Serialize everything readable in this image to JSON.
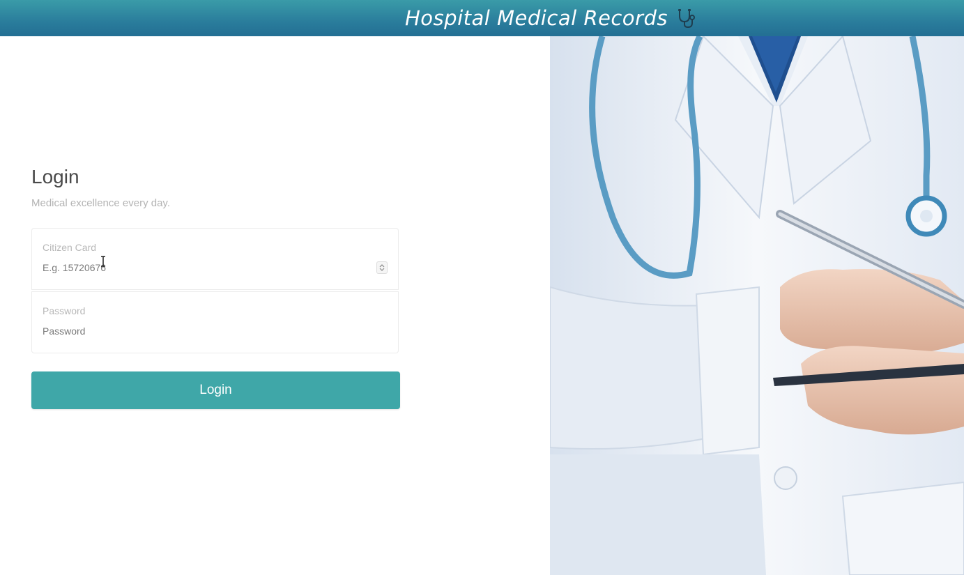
{
  "header": {
    "title": "Hospital Medical Records",
    "icon": "stethoscope-icon"
  },
  "login": {
    "heading": "Login",
    "subtitle": "Medical excellence every day.",
    "citizen_card": {
      "label": "Citizen Card",
      "placeholder": "E.g. 15720676",
      "value": ""
    },
    "password": {
      "label": "Password",
      "placeholder": "Password",
      "value": ""
    },
    "button_label": "Login"
  },
  "colors": {
    "header": "#2a7d9c",
    "accent": "#3fa7a8"
  }
}
